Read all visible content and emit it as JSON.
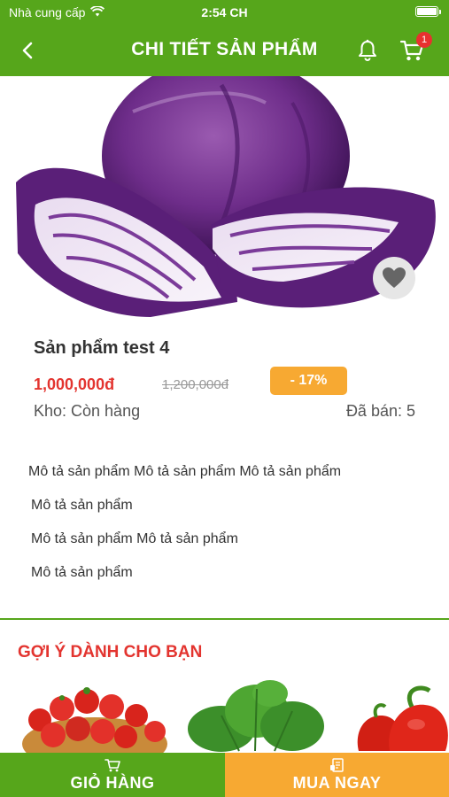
{
  "status_bar": {
    "carrier": "Nhà cung cấp",
    "time": "2:54 CH",
    "battery_level": 1.0
  },
  "header": {
    "title": "CHI TIẾT SẢN PHẨM",
    "cart_count": "1",
    "color": "#56a61b"
  },
  "icons": {
    "back": "chevron-left-icon",
    "bell": "bell-icon",
    "cart": "cart-icon",
    "favorite": "heart-icon",
    "wifi": "wifi-icon",
    "battery": "battery-icon"
  },
  "product": {
    "name": "Sản phẩm test 4",
    "price": "1,000,000đ",
    "old_price": "1,200,000đ",
    "discount": "- 17%",
    "stock": "Kho: Còn hàng",
    "sold": "Đã bán: 5"
  },
  "description": [
    "Mô tả sản phẩm Mô tả sản phẩm Mô tả sản phẩm",
    "Mô tả sản phẩm",
    "Mô tả sản phẩm Mô tả sản phẩm",
    "Mô tả sản phẩm"
  ],
  "suggestions": {
    "title": "GỢI Ý DÀNH CHO BẠN"
  },
  "actions": {
    "add_to_cart": "GIỎ HÀNG",
    "buy_now": "MUA NGAY"
  },
  "colors": {
    "primary": "#56a61b",
    "accent": "#f7a932",
    "price": "#e3342f"
  }
}
